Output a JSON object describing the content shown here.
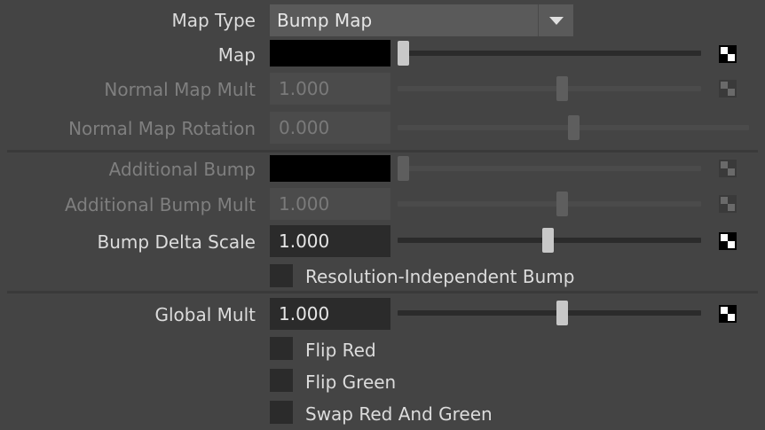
{
  "map_type": {
    "label": "Map Type",
    "value": "Bump Map"
  },
  "rows": {
    "map": {
      "label": "Map",
      "slider_value": 0.0
    },
    "normal_map_mult": {
      "label": "Normal Map Mult",
      "value": "1.000",
      "slider_value": 0.5
    },
    "normal_map_rotation": {
      "label": "Normal Map Rotation",
      "value": "0.000",
      "slider_value": 0.5
    },
    "additional_bump": {
      "label": "Additional Bump",
      "slider_value": 0.0
    },
    "additional_bump_mult": {
      "label": "Additional Bump Mult",
      "value": "1.000",
      "slider_value": 0.5
    },
    "bump_delta_scale": {
      "label": "Bump Delta Scale",
      "value": "1.000",
      "slider_value": 0.5
    },
    "global_mult": {
      "label": "Global Mult",
      "value": "1.000",
      "slider_value": 0.5
    }
  },
  "checkboxes": {
    "resolution_independent_bump": {
      "label": "Resolution-Independent Bump",
      "checked": false
    },
    "flip_red": {
      "label": "Flip Red",
      "checked": false
    },
    "flip_green": {
      "label": "Flip Green",
      "checked": false
    },
    "swap_red_green": {
      "label": "Swap Red And Green",
      "checked": false
    }
  },
  "colors": {
    "background": "#444444",
    "field": "#2b2b2b",
    "text": "#dcdcdc",
    "dim_text": "#7f7f7f",
    "handle": "#c8c8c8"
  },
  "icons": {
    "map_button": "checker-icon",
    "dropdown": "chevron-down-icon"
  }
}
